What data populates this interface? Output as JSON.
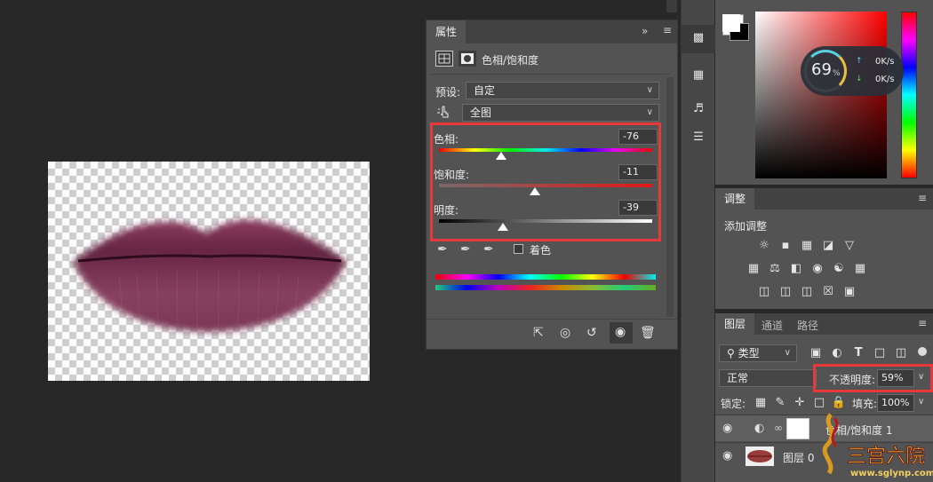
{
  "properties_panel": {
    "tab_label": "属性",
    "collapse_glyph": "»",
    "menu_glyph": "≡",
    "adjustment_title": "色相/饱和度",
    "preset_label": "预设:",
    "preset_value": "自定",
    "channel_value": "全图",
    "hue_label": "色相:",
    "hue_value": "-76",
    "hue_fraction": 0.29,
    "saturation_label": "饱和度:",
    "saturation_value": "-11",
    "saturation_fraction": 0.45,
    "lightness_label": "明度:",
    "lightness_value": "-39",
    "lightness_fraction": 0.3,
    "colorize_label": "着色",
    "highlight_color": "#e8393a"
  },
  "color_panel": {
    "perf_percent": "69",
    "perf_unit": "%",
    "upload_rate": "0K/s",
    "download_rate": "0K/s"
  },
  "adjustments_panel": {
    "tab_label": "调整",
    "subtitle": "添加调整"
  },
  "layers_panel": {
    "tabs": [
      "图层",
      "通道",
      "路径"
    ],
    "filter_kind": "类型",
    "blend_mode": "正常",
    "opacity_label": "不透明度:",
    "opacity_value": "59%",
    "lock_label": "锁定:",
    "fill_label": "填充:",
    "fill_value": "100%",
    "layers": [
      {
        "name": "色相/饱和度 1"
      },
      {
        "name": "图层 0"
      }
    ]
  },
  "watermark": {
    "url": "www.sglynp.com"
  }
}
